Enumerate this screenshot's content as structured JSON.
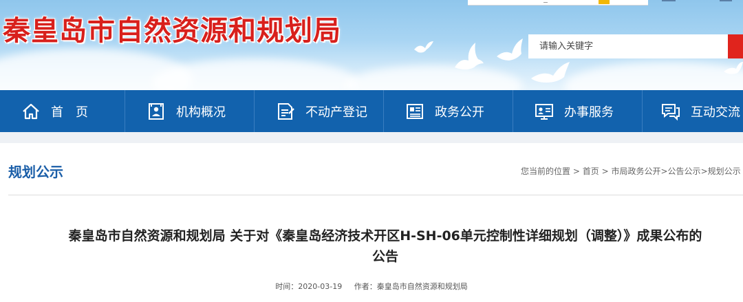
{
  "site": {
    "title": "秦皇岛市自然资源和规划局",
    "search_placeholder": "请输入关键字"
  },
  "nav": {
    "items": [
      {
        "label": "首　页",
        "icon": "home-icon"
      },
      {
        "label": "机构概况",
        "icon": "org-profile-icon"
      },
      {
        "label": "不动产登记",
        "icon": "property-registration-icon"
      },
      {
        "label": "政务公开",
        "icon": "government-affairs-icon"
      },
      {
        "label": "办事服务",
        "icon": "services-icon"
      },
      {
        "label": "互动交流",
        "icon": "interaction-icon"
      }
    ]
  },
  "section": {
    "title": "规划公示",
    "breadcrumb": {
      "prefix": "您当前的位置",
      "items": [
        "首页",
        "市局政务公开",
        "公告公示",
        "规划公示"
      ],
      "separator": ">"
    }
  },
  "article": {
    "title_line1": "秦皇岛市自然资源和规划局 关于对《秦皇岛经济技术开区H-SH-06单元控制性详细规划（调整）》成果公布的",
    "title_line2": "公告",
    "time_label": "时间：",
    "time": "2020-03-19",
    "author_label": "作者：",
    "author": "秦皇岛市自然资源和规划局"
  },
  "colors": {
    "brand_red": "#d8201c",
    "nav_blue": "#1262ad",
    "section_blue": "#1a5ea8",
    "search_button_red": "#e0241d"
  }
}
